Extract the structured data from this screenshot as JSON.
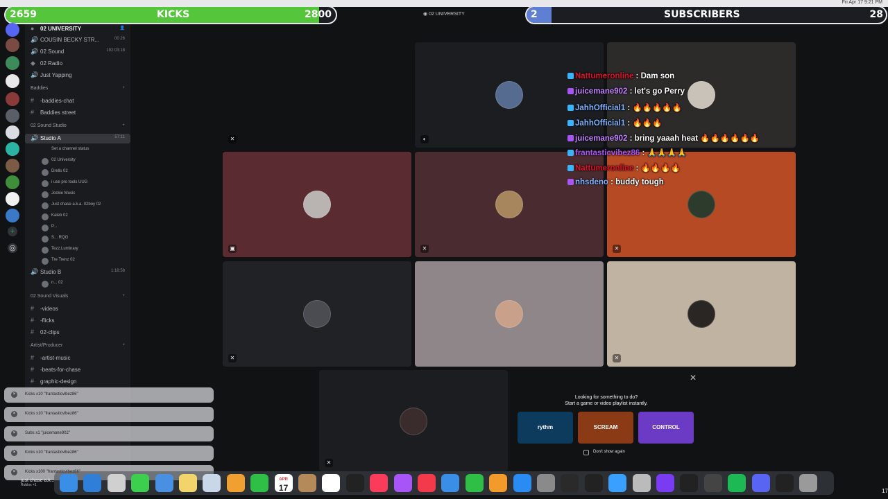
{
  "menubar": {
    "right_text": "Fri Apr 17 9:21 PM"
  },
  "kicks_bar": {
    "left": "2659",
    "label": "KICKS",
    "right": "2800",
    "progress": 0.95
  },
  "subs_bar": {
    "left": "2",
    "label": "SUBSCRIBERS",
    "right": "28",
    "progress": 0.07
  },
  "channel_header": "02 UNIVERSITY",
  "sidebar": {
    "server_name": "02 UNIVERSITY",
    "items": [
      {
        "kind": "voice",
        "label": "COUSIN BECKY STR...",
        "right": "00 26"
      },
      {
        "kind": "voice",
        "label": "02 Sound",
        "right": "192:03:18"
      },
      {
        "kind": "sub",
        "label": "02 Radio",
        "right": ""
      },
      {
        "kind": "voice",
        "label": "Just Yapping",
        "right": ""
      },
      {
        "kind": "cat",
        "label": "Baddies",
        "right": "+"
      },
      {
        "kind": "text",
        "label": "-baddies-chat",
        "right": ""
      },
      {
        "kind": "text",
        "label": "Baddies street",
        "right": ""
      },
      {
        "kind": "cat",
        "label": "02 Sound Studio",
        "right": "+"
      },
      {
        "kind": "voice-sel",
        "label": "Studio A",
        "right": "57:11"
      },
      {
        "kind": "status",
        "label": "Set a channel status",
        "right": ""
      },
      {
        "kind": "user",
        "label": "02 University",
        "right": ""
      },
      {
        "kind": "user",
        "label": "Drells  02",
        "right": ""
      },
      {
        "kind": "user",
        "label": "i use pro tools  UUG",
        "right": ""
      },
      {
        "kind": "user",
        "label": "Jockie Music",
        "right": ""
      },
      {
        "kind": "user",
        "label": "Just chase a.k.a. 02boy  02",
        "right": ""
      },
      {
        "kind": "user",
        "label": "Kaleb  02",
        "right": ""
      },
      {
        "kind": "user",
        "label": "P...",
        "right": ""
      },
      {
        "kind": "user",
        "label": "S...  RQG",
        "right": ""
      },
      {
        "kind": "user",
        "label": "Tezz.Luminary",
        "right": ""
      },
      {
        "kind": "user",
        "label": "Tre Trenz  02",
        "right": ""
      },
      {
        "kind": "voice",
        "label": "Studio B",
        "right": "1:18:58"
      },
      {
        "kind": "user",
        "label": "n...  02",
        "right": ""
      },
      {
        "kind": "cat",
        "label": "02 Sound Visuals",
        "right": "+"
      },
      {
        "kind": "text",
        "label": "-videos",
        "right": ""
      },
      {
        "kind": "text",
        "label": "-flicks",
        "right": ""
      },
      {
        "kind": "text",
        "label": "02-clips",
        "right": ""
      },
      {
        "kind": "cat",
        "label": "Artist/Producer",
        "right": "+"
      },
      {
        "kind": "text",
        "label": "-artist-music",
        "right": ""
      },
      {
        "kind": "text",
        "label": "-beats-for-chase",
        "right": ""
      },
      {
        "kind": "text",
        "label": "graphic-design",
        "right": ""
      }
    ]
  },
  "chat": [
    {
      "user": "Nattumeronline",
      "text": "Dam son",
      "color": "#e0102a"
    },
    {
      "user": "juicemane902",
      "text": "let's go Perry",
      "color": "#c283ff"
    },
    {
      "user": "JahhOfficial1",
      "text": "🔥🔥🔥🔥🔥",
      "color": "#7fb2ff"
    },
    {
      "user": "JahhOfficial1",
      "text": "🔥🔥🔥",
      "color": "#7fb2ff"
    },
    {
      "user": "juicemane902",
      "text": "bring yaaah heat 🔥🔥🔥🔥🔥🔥",
      "color": "#c283ff"
    },
    {
      "user": "frantasticvibez86",
      "text": "🙏🙏🙏🙏",
      "color": "#a855f7"
    },
    {
      "user": "Nattumeronline",
      "text": "🔥🔥🔥🔥",
      "color": "#e0102a"
    },
    {
      "user": "nhsdeno",
      "text": "buddy tough",
      "color": "#7fb2ff"
    }
  ],
  "activity": {
    "line1": "Looking for something to do?",
    "line2": "Start a game or video playlist instantly.",
    "cards": [
      "rythm",
      "SCREAM",
      "CONTROL"
    ],
    "dont_show": "Don't show again"
  },
  "notifications": [
    "Kicks x10 \"frantasticvibez86\"",
    "Kicks x10 \"frantasticvibez86\"",
    "Subs x1 \"juicemane902\"",
    "Kicks x10 \"frantasticvibez86\"",
    "Kicks x100 \"frantasticvibez86\""
  ],
  "user_panel": {
    "name": "just chase a.k...",
    "sub": "Roblox +1"
  },
  "dock": {
    "calendar_date": "17",
    "calendar_month": "APR",
    "apps": [
      "finder",
      "safari",
      "launchpad",
      "messages",
      "mail",
      "notes",
      "preview",
      "photos",
      "facetime",
      "calendar",
      "contacts",
      "reminders",
      "tv",
      "music",
      "podcasts",
      "news",
      "keynote",
      "numbers",
      "pages",
      "app-store",
      "system-settings",
      "logic",
      "ilok",
      "alexa",
      "compressor",
      "ableton",
      "mixer",
      "tuner",
      "spotify",
      "discord",
      "clock",
      "trash"
    ]
  },
  "corner_num": "17"
}
